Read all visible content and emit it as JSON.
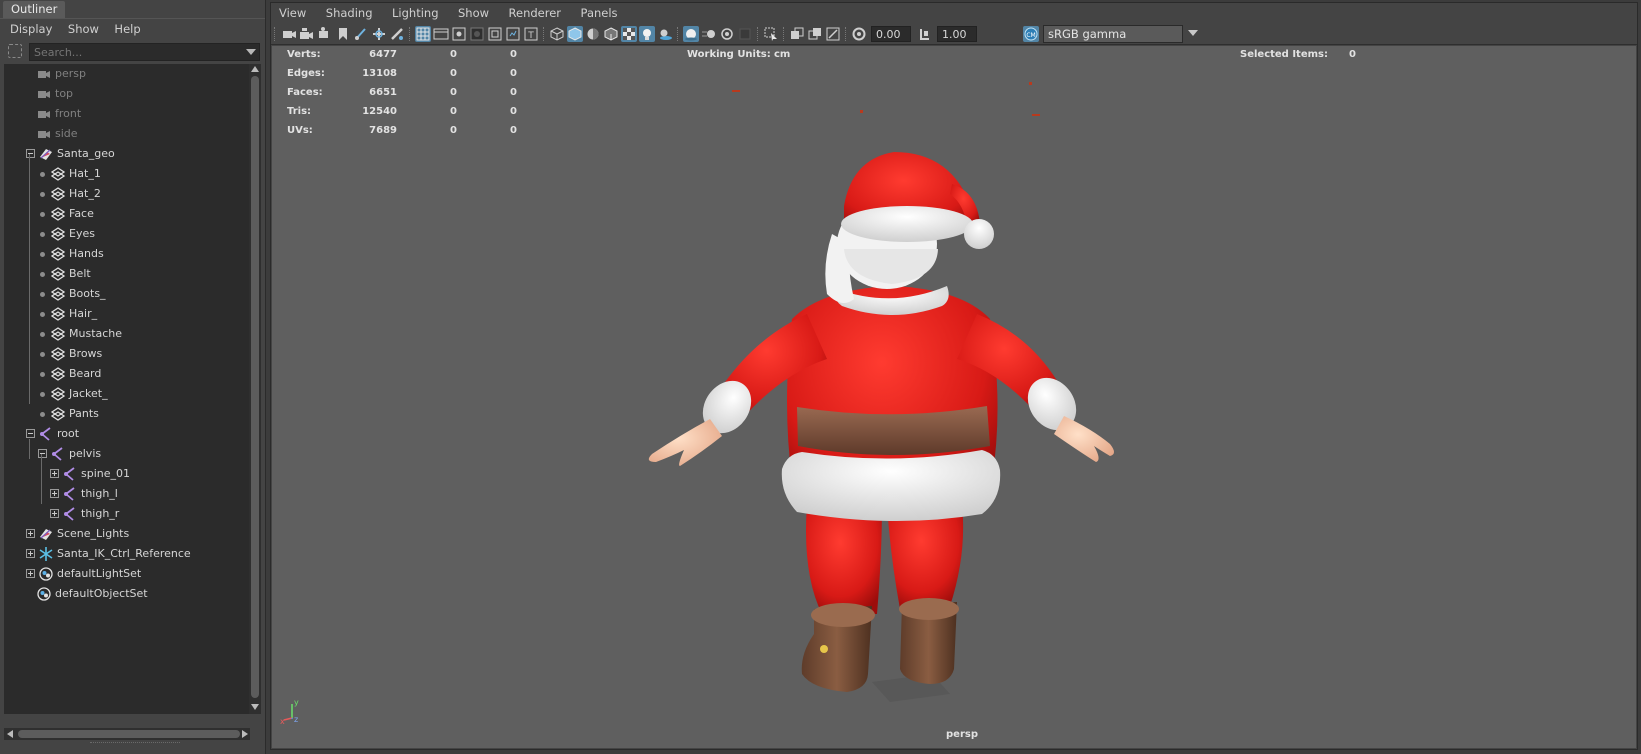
{
  "outliner": {
    "tab_label": "Outliner",
    "menu": [
      "Display",
      "Show",
      "Help"
    ],
    "search_placeholder": "Search...",
    "items": [
      {
        "label": "persp",
        "icon": "camera-icon",
        "dim": true
      },
      {
        "label": "top",
        "icon": "camera-icon",
        "dim": true
      },
      {
        "label": "front",
        "icon": "camera-icon",
        "dim": true
      },
      {
        "label": "side",
        "icon": "camera-icon",
        "dim": true
      },
      {
        "label": "Santa_geo",
        "icon": "group-transform-icon",
        "expanded": true
      },
      {
        "label": "Hat_1",
        "icon": "mesh-icon"
      },
      {
        "label": "Hat_2",
        "icon": "mesh-icon"
      },
      {
        "label": "Face",
        "icon": "mesh-icon"
      },
      {
        "label": "Eyes",
        "icon": "mesh-icon"
      },
      {
        "label": "Hands",
        "icon": "mesh-icon"
      },
      {
        "label": "Belt",
        "icon": "mesh-icon"
      },
      {
        "label": "Boots_",
        "icon": "mesh-icon"
      },
      {
        "label": "Hair_",
        "icon": "mesh-icon"
      },
      {
        "label": "Mustache",
        "icon": "mesh-icon"
      },
      {
        "label": "Brows",
        "icon": "mesh-icon"
      },
      {
        "label": "Beard",
        "icon": "mesh-icon"
      },
      {
        "label": "Jacket_",
        "icon": "mesh-icon"
      },
      {
        "label": "Pants",
        "icon": "mesh-icon"
      },
      {
        "label": "root",
        "icon": "joint-icon",
        "expanded": true
      },
      {
        "label": "pelvis",
        "icon": "joint-icon",
        "expanded": true
      },
      {
        "label": "spine_01",
        "icon": "joint-icon"
      },
      {
        "label": "thigh_l",
        "icon": "joint-icon"
      },
      {
        "label": "thigh_r",
        "icon": "joint-icon"
      },
      {
        "label": "Scene_Lights",
        "icon": "group-transform-icon"
      },
      {
        "label": "Santa_IK_Ctrl_Reference",
        "icon": "ik-control-icon"
      },
      {
        "label": "defaultLightSet",
        "icon": "set-icon"
      },
      {
        "label": "defaultObjectSet",
        "icon": "set-icon"
      }
    ]
  },
  "viewport": {
    "menu": [
      "View",
      "Shading",
      "Lighting",
      "Show",
      "Renderer",
      "Panels"
    ],
    "exposure": "0.00",
    "gamma": "1.00",
    "color_space": "sRGB gamma",
    "camera": "persp",
    "hud": {
      "rows": [
        {
          "label": "Verts:",
          "values": [
            "6477",
            "0",
            "0"
          ]
        },
        {
          "label": "Edges:",
          "values": [
            "13108",
            "0",
            "0"
          ]
        },
        {
          "label": "Faces:",
          "values": [
            "6651",
            "0",
            "0"
          ]
        },
        {
          "label": "Tris:",
          "values": [
            "12540",
            "0",
            "0"
          ]
        },
        {
          "label": "UVs:",
          "values": [
            "7689",
            "0",
            "0"
          ]
        }
      ],
      "working_units_label": "Working Units:",
      "working_units_value": "cm",
      "selected_items_label": "Selected Items:",
      "selected_items_value": "0"
    },
    "axis_labels": {
      "x": "x",
      "y": "y",
      "z": "z"
    }
  },
  "colors": {
    "accent": "#5285a6",
    "viewport_bg": "#5f5f5f",
    "panel_bg": "#444444",
    "santa_red": "#e0201c",
    "fur_white": "#f4f4f4",
    "belt_brown": "#7a4a32"
  }
}
